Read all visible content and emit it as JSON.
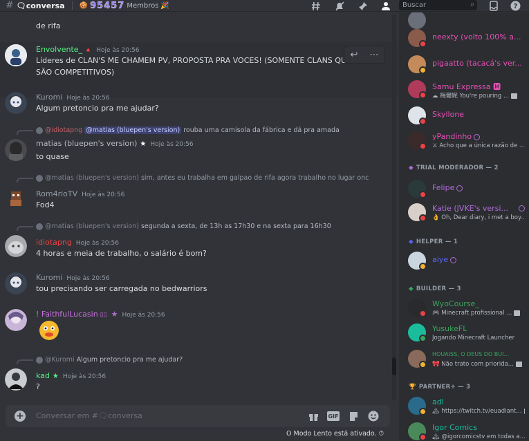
{
  "topbar": {
    "channel": "🗨conversa",
    "topic_number": "95457",
    "topic_suffix": "Membros",
    "search_placeholder": "Buscar"
  },
  "messages": [
    {
      "name": "",
      "time": "",
      "text": "de rifa"
    },
    {
      "name": "Envolvente_",
      "time": "Hoje às 20:56",
      "text": "Líderes de CLAN'S ME CHAMEM PV, PROPOSTA PRA VOCES! (SOMENTE CLANS QUE SÃO COMPETITIVOS)"
    },
    {
      "name": "Kuromi",
      "time": "Hoje às 20:56",
      "text": "Algum pretoncio pra me ajudar?"
    },
    {
      "reply_user": "@idiotapng",
      "reply_mention": "@matias (bluepen's version)",
      "reply_text": "rouba uma camisola da fábrica e dá pra amada",
      "name": "matias (bluepen's version)",
      "time": "Hoje às 20:56",
      "text": "to quase"
    },
    {
      "reply_user": "@matias (bluepen's version)",
      "reply_text": "sim, antes eu trabalha em galpao de rifa agora trabalho no lugar onc",
      "name": "Rom4rioTV",
      "time": "Hoje às 20:56",
      "text": "Fod4"
    },
    {
      "reply_user": "@matias (bluepen's version)",
      "reply_text": "segunda a sexta, de 13h as 17h30 e na sexta para 16h30",
      "name": "idiotapng",
      "time": "Hoje às 20:56",
      "text": "4 horas e meia de trabalho, o salário é bom?"
    },
    {
      "name": "Kuromi",
      "time": "Hoje às 20:56",
      "text": "tou precisando ser carregada no bedwarriors"
    },
    {
      "name": "! FaithfulLucasin",
      "time": "Hoje às 20:56",
      "text": ""
    },
    {
      "reply_user": "@Kuromi",
      "reply_text": "Algum pretoncio pra me ajudar?",
      "name": "kad",
      "time": "Hoje às 20:56",
      "text": "?"
    }
  ],
  "composer": {
    "placeholder": "Conversar em #🗨conversa",
    "gif_label": "GIF",
    "slowmode": "O Modo Lento está ativado."
  },
  "members": {
    "rows": [
      {
        "name": "neexty (volto 100% a...",
        "sub": ""
      },
      {
        "name": "pigaatto (tacacá's ver...",
        "sub": ""
      },
      {
        "name": "Samu Expressa 🅼",
        "sub": "☁ 梅爾妮 You're pouring ..."
      },
      {
        "name": "Skyllone",
        "sub": ""
      },
      {
        "name": "yPandinho",
        "sub": "⚔ Acho que a única razão de ..."
      },
      {
        "name": "Felipe",
        "sub": ""
      },
      {
        "name": "Katie (JVKE's versi...",
        "sub": "👌 Oh, Dear diary, i met a boy..."
      },
      {
        "name": "aiye",
        "sub": ""
      },
      {
        "name": "WyoCourse_",
        "sub": "🎮 Minecraft profissional ..."
      },
      {
        "name": "YusukeFL",
        "sub": "Jogando Minecraft Launcher"
      },
      {
        "name": "HOUAISS, O DEUS DO BUI...",
        "sub": "🎀 Não trato com priorida..."
      },
      {
        "name": "adl",
        "sub": "🏔 https://twitch.tv/euadiant..."
      },
      {
        "name": "Igor Comics",
        "sub": "🏔 @igorcomicstv em todas a..."
      }
    ],
    "headers": [
      "TRIAL MODERADOR — 2",
      "HELPER — 1",
      "BUILDER — 3",
      "PARTNER+ — 3"
    ]
  },
  "colors": {
    "envolvente": "#57f287",
    "kuromi": "#949ba4",
    "matias": "#b5bac1",
    "rom": "#949ba4",
    "idiota": "#ed4245",
    "faithful": "#c86ee0",
    "kad": "#57f287",
    "member_pink": "#e94fb6",
    "member_purple": "#b16dd6",
    "member_blue": "#5865f2",
    "member_green": "#3ba55c",
    "member_teal": "#1abc9c"
  },
  "icons": [
    "threads-icon",
    "mute-icon",
    "pin-icon",
    "members-icon",
    "search-icon",
    "inbox-icon",
    "help-icon"
  ]
}
